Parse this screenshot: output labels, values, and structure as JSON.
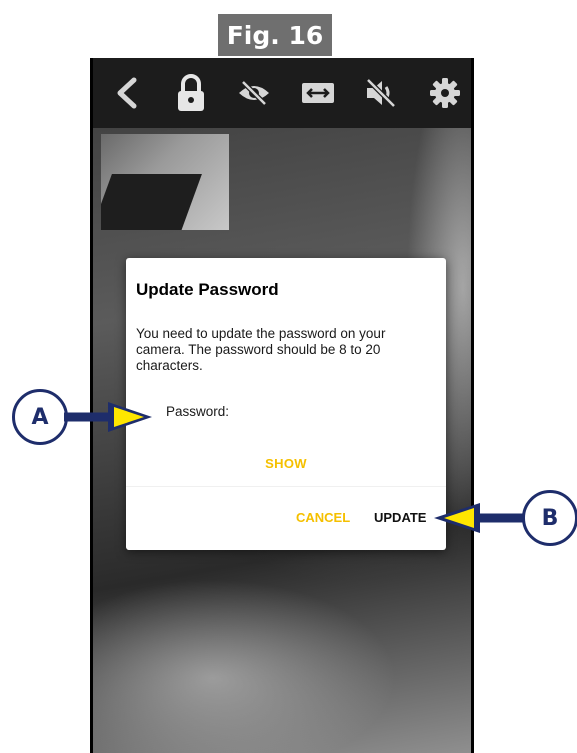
{
  "figure": {
    "label": "Fig. 16"
  },
  "toolbar": {
    "icons": [
      "back-icon",
      "lock-icon",
      "eye-off-icon",
      "resize-icon",
      "mute-icon",
      "gear-icon"
    ]
  },
  "dialog": {
    "title": "Update Password",
    "message": "You need to update the password on your camera. The password should be 8 to 20 characters.",
    "password_label": "Password:",
    "show_label": "SHOW",
    "cancel_label": "CANCEL",
    "update_label": "UPDATE"
  },
  "callouts": {
    "a": "A",
    "b": "B"
  },
  "colors": {
    "accent": "#f5c000",
    "callout_navy": "#1e2d6b",
    "arrow_yellow": "#ffe600"
  }
}
